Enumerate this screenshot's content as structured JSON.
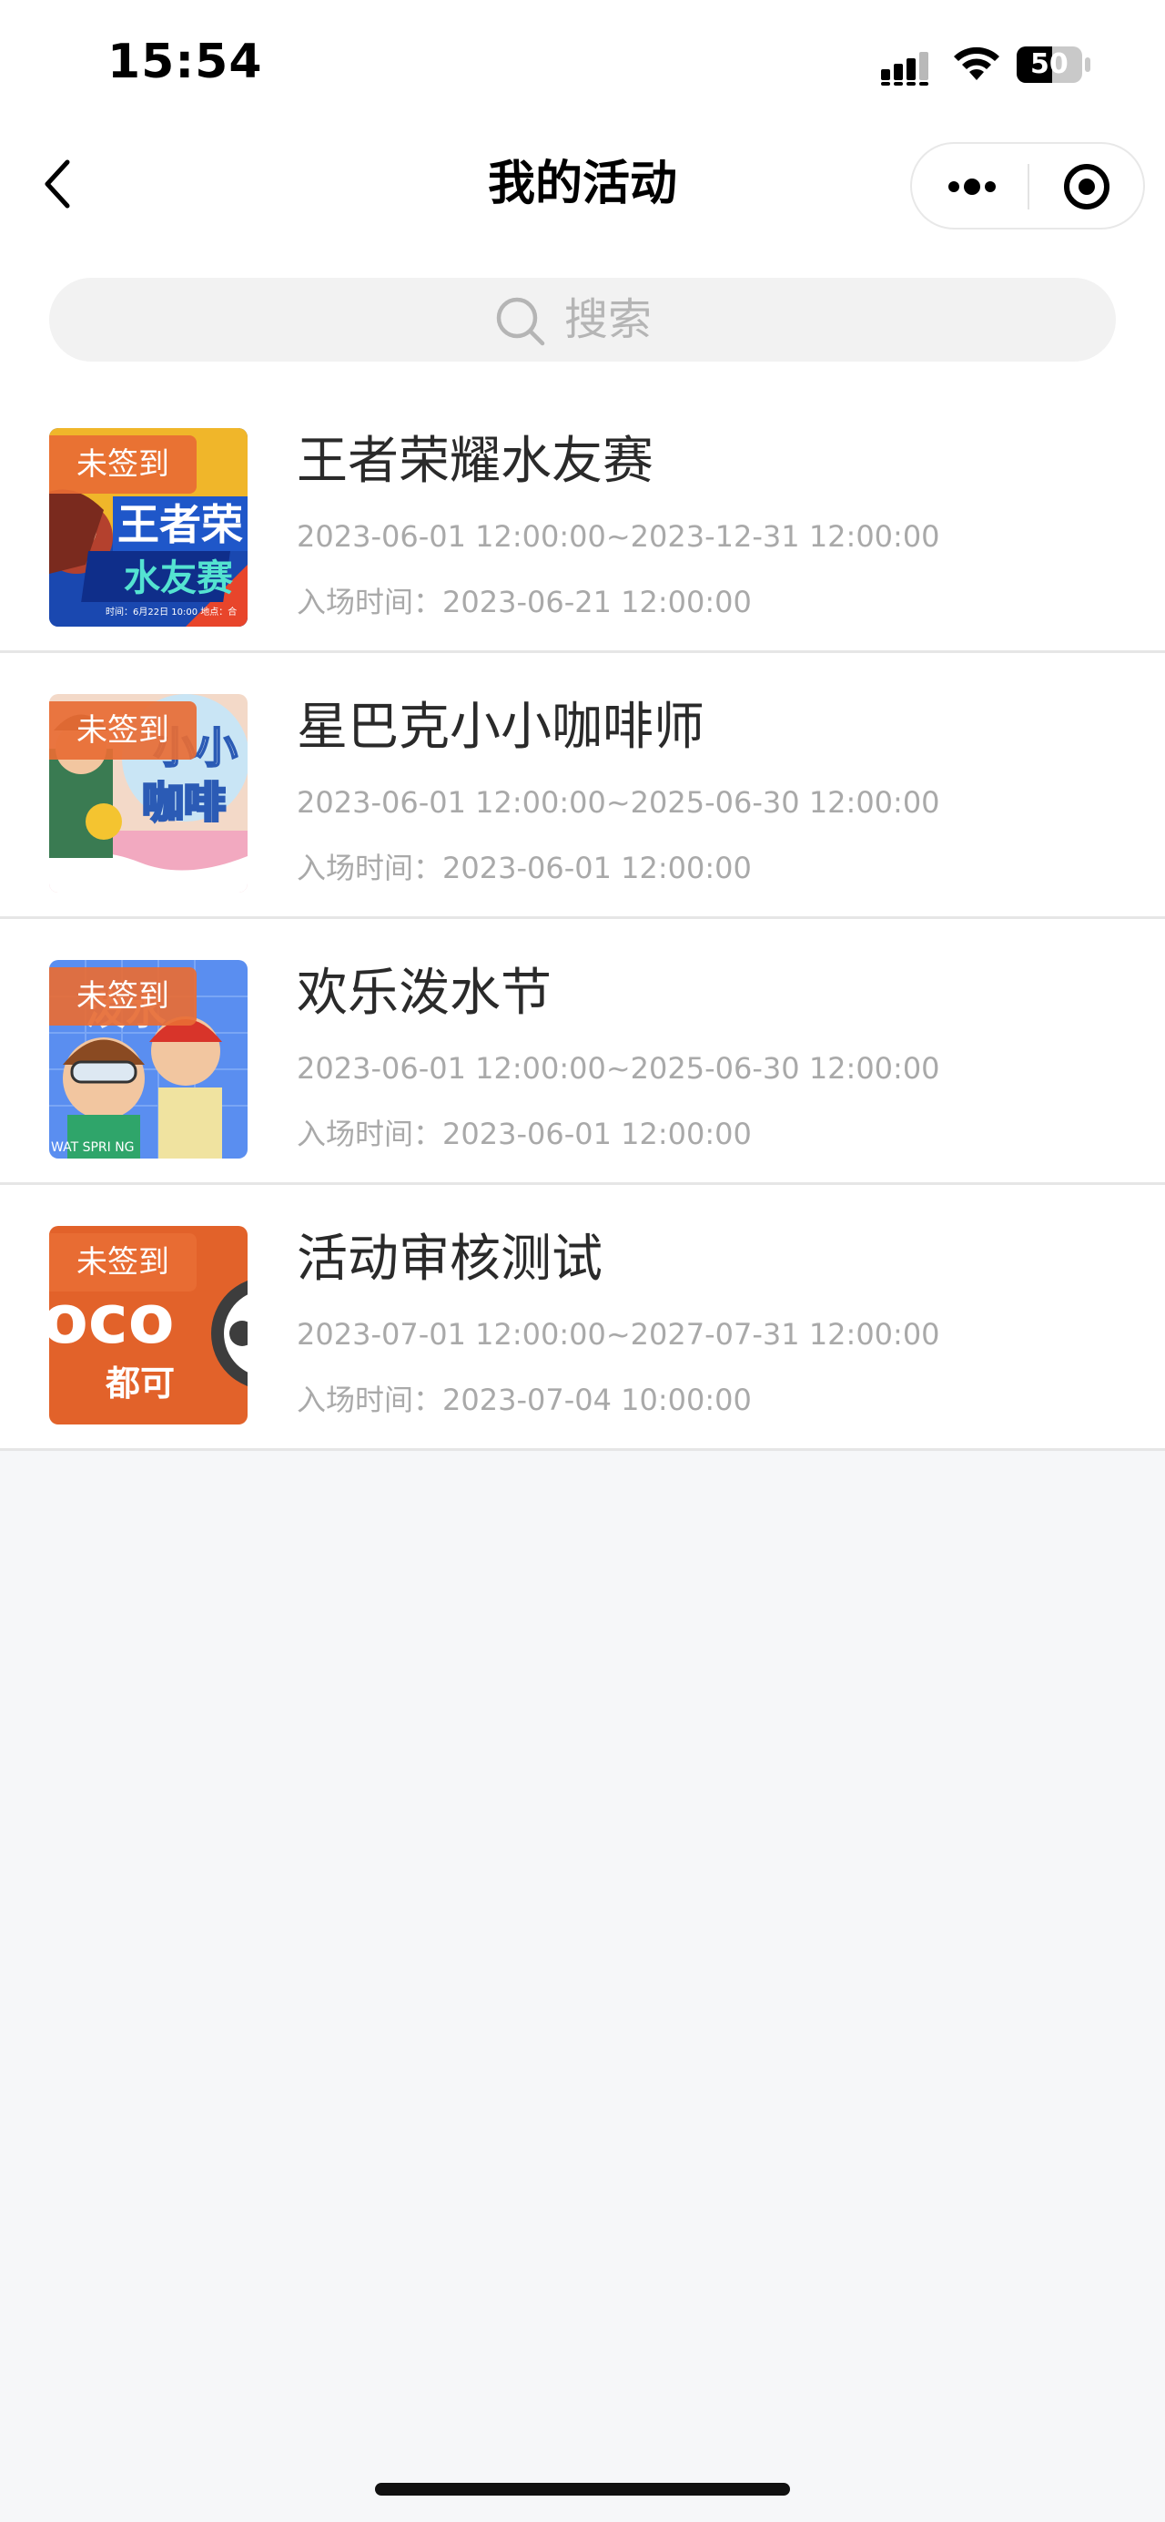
{
  "status_bar": {
    "time": "15:54",
    "battery": "50"
  },
  "nav": {
    "title": "我的活动"
  },
  "search": {
    "placeholder": "搜索"
  },
  "activities": [
    {
      "title": "王者荣耀水友赛",
      "badge": "未签到",
      "period": "2023-06-01 12:00:00~2023-12-31 12:00:00",
      "entry": "入场时间：2023-06-21 12:00:00",
      "thumb_texts": [
        "王者荣",
        "水友赛",
        "时间：6月22日 10:00  地点：合"
      ]
    },
    {
      "title": "星巴克小小咖啡师",
      "badge": "未签到",
      "period": "2023-06-01 12:00:00~2025-06-30 12:00:00",
      "entry": "入场时间：2023-06-01 12:00:00",
      "thumb_texts": [
        "小小",
        "咖啡"
      ]
    },
    {
      "title": "欢乐泼水节",
      "badge": "未签到",
      "period": "2023-06-01 12:00:00~2025-06-30 12:00:00",
      "entry": "入场时间：2023-06-01 12:00:00",
      "thumb_texts": [
        "泼水",
        "WAT  SPRI  NG"
      ]
    },
    {
      "title": "活动审核测试",
      "badge": "未签到",
      "period": "2023-07-01 12:00:00~2027-07-31 12:00:00",
      "entry": "入场时间：2023-07-04 10:00:00",
      "thumb_texts": [
        "oco",
        "都可"
      ]
    }
  ],
  "colors": {
    "badge": "#e86c34",
    "accent_orange": "#e2622a",
    "text_primary": "#2a2a2a",
    "text_secondary": "#a9a9a9",
    "page_bg": "#f6f7f9"
  },
  "icons": {
    "back": "back-arrow-icon",
    "more": "more-dots-icon",
    "close": "target-circle-icon",
    "search": "search-icon",
    "signal": "signal-icon",
    "wifi": "wifi-icon",
    "battery": "battery-icon"
  }
}
